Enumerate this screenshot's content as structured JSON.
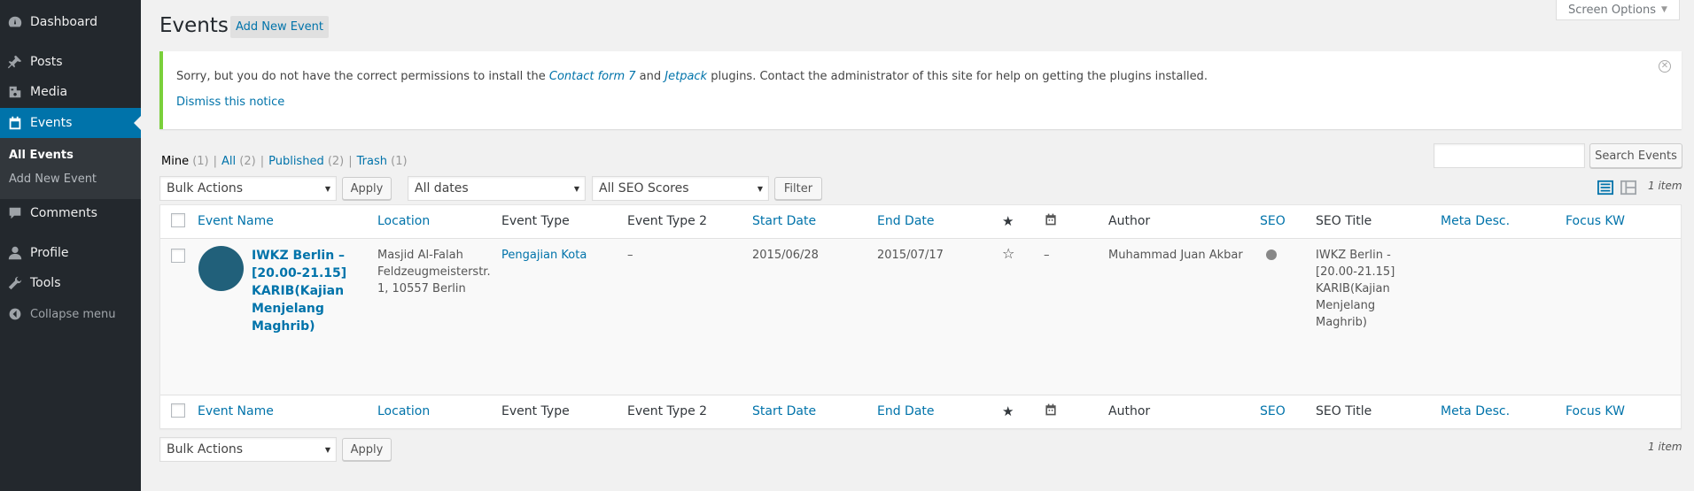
{
  "sidebar": {
    "items": [
      {
        "label": "Dashboard",
        "icon": "dashboard-icon"
      },
      {
        "label": "Posts",
        "icon": "pin-icon"
      },
      {
        "label": "Media",
        "icon": "media-icon"
      },
      {
        "label": "Events",
        "icon": "calendar-icon"
      },
      {
        "label": "Comments",
        "icon": "comment-icon"
      },
      {
        "label": "Profile",
        "icon": "user-icon"
      },
      {
        "label": "Tools",
        "icon": "wrench-icon"
      }
    ],
    "submenu": [
      "All Events",
      "Add New Event"
    ],
    "collapse": "Collapse menu"
  },
  "header": {
    "title": "Events",
    "add_new": "Add New Event",
    "screen_options": "Screen Options"
  },
  "notice": {
    "text_before": "Sorry, but you do not have the correct permissions to install the ",
    "plugin1": "Contact form 7",
    "and": " and ",
    "plugin2": "Jetpack",
    "text_after": " plugins. Contact the administrator of this site for help on getting the plugins installed.",
    "dismiss": "Dismiss this notice"
  },
  "views": [
    {
      "label": "Mine",
      "count": "(1)"
    },
    {
      "label": "All",
      "count": "(2)"
    },
    {
      "label": "Published",
      "count": "(2)"
    },
    {
      "label": "Trash",
      "count": "(1)"
    }
  ],
  "search": {
    "value": "",
    "button": "Search Events"
  },
  "filters": {
    "bulk_actions": "Bulk Actions",
    "apply": "Apply",
    "dates": "All dates",
    "seo_scores": "All SEO Scores",
    "filter": "Filter",
    "items": "1 item"
  },
  "table": {
    "columns": [
      "Event Name",
      "Location",
      "Event Type",
      "Event Type 2",
      "Start Date",
      "End Date",
      "Author",
      "SEO",
      "SEO Title",
      "Meta Desc.",
      "Focus KW"
    ],
    "row": {
      "title_lines": [
        "IWKZ Berlin –",
        "[20.00-21.15]",
        "KARIB(Kajian",
        "Menjelang",
        "Maghrib)"
      ],
      "location_lines": [
        "Masjid Al-Falah",
        "Feldzeugmeisterstr.",
        "1, 10557 Berlin"
      ],
      "event_type": "Pengajian Kota",
      "event_type2": "–",
      "start_date": "2015/06/28",
      "end_date": "2015/07/17",
      "calendar_value": "–",
      "author": "Muhammad Juan Akbar",
      "seo_title_lines": [
        "IWKZ Berlin -",
        "[20.00-21.15]",
        "KARIB(Kajian",
        "Menjelang",
        "Maghrib)"
      ]
    }
  },
  "colors": {
    "sidebar": "#23282d",
    "accent": "#0073aa",
    "notice_border": "#7ad03a"
  }
}
